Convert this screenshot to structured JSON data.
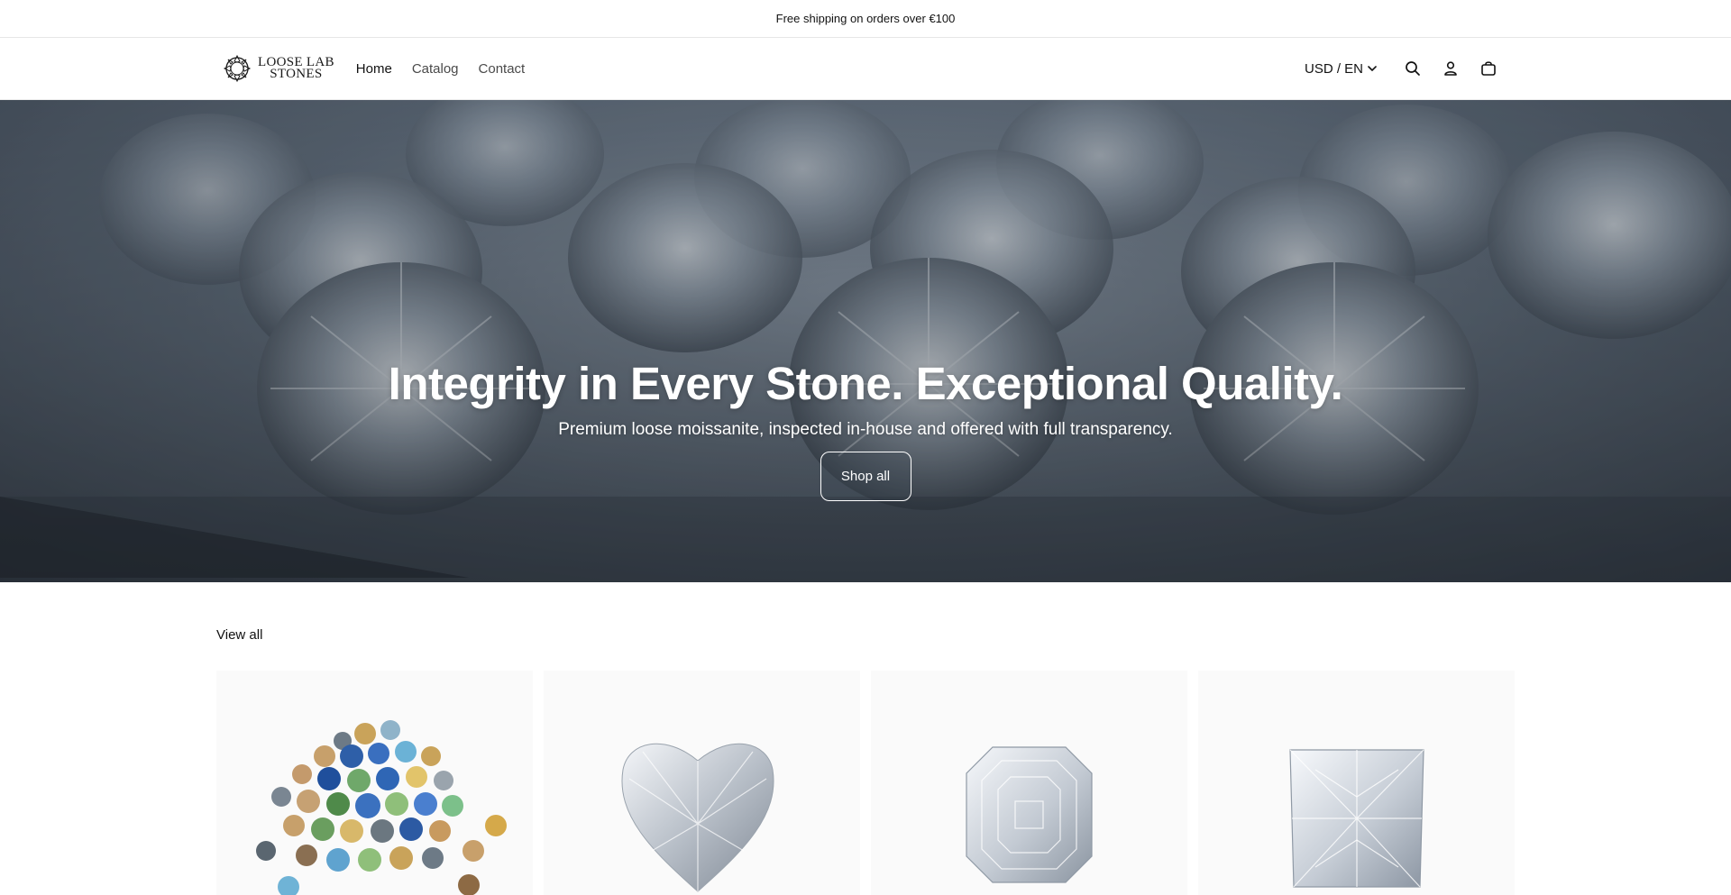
{
  "announcement": {
    "text": "Free shipping on orders over €100"
  },
  "header": {
    "logo": {
      "line1": "LOOSE LAB",
      "line2": "STONES"
    },
    "nav": [
      {
        "label": "Home",
        "active": true
      },
      {
        "label": "Catalog",
        "active": false
      },
      {
        "label": "Contact",
        "active": false
      }
    ],
    "locale_label": "USD / EN",
    "icons": [
      "chevron-down-icon",
      "search-icon",
      "account-icon",
      "cart-icon"
    ]
  },
  "hero": {
    "title": "Integrity in Every Stone. Exceptional Quality.",
    "subtitle": "Premium loose moissanite, inspected in-house and offered with full transparency.",
    "button_label": "Shop all"
  },
  "collection": {
    "view_all_label": "View all",
    "products": [
      {
        "image": "assorted-colored-stones"
      },
      {
        "image": "heart-cut-stone"
      },
      {
        "image": "asscher-cut-stone"
      },
      {
        "image": "princess-cut-stone"
      }
    ]
  },
  "colors": {
    "text": "#121212",
    "muted_text": "#4a4a4a",
    "border": "#e6e6e6",
    "card_background": "#fafafa",
    "hero_overlay": "#5c6876"
  }
}
